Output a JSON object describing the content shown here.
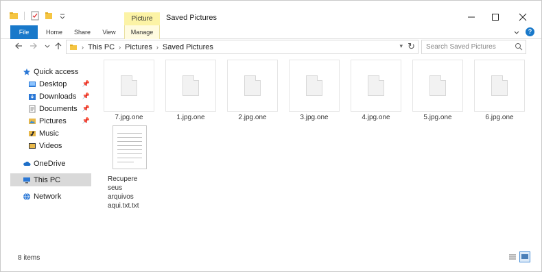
{
  "window": {
    "title": "Saved Pictures",
    "contextual_group": "Picture Tools"
  },
  "ribbon": {
    "tabs": [
      "File",
      "Home",
      "Share",
      "View",
      "Manage"
    ]
  },
  "address": {
    "crumbs": [
      "This PC",
      "Pictures",
      "Saved Pictures"
    ]
  },
  "search": {
    "placeholder": "Search Saved Pictures"
  },
  "sidebar": {
    "items": [
      {
        "label": "Quick access",
        "icon": "star-icon"
      },
      {
        "label": "Desktop",
        "icon": "desktop-folder-icon",
        "pinned": true
      },
      {
        "label": "Downloads",
        "icon": "downloads-folder-icon",
        "pinned": true
      },
      {
        "label": "Documents",
        "icon": "documents-folder-icon",
        "pinned": true
      },
      {
        "label": "Pictures",
        "icon": "pictures-folder-icon",
        "pinned": true
      },
      {
        "label": "Music",
        "icon": "music-folder-icon"
      },
      {
        "label": "Videos",
        "icon": "videos-folder-icon"
      },
      {
        "label": "OneDrive",
        "icon": "cloud-icon"
      },
      {
        "label": "This PC",
        "icon": "computer-icon",
        "selected": true
      },
      {
        "label": "Network",
        "icon": "network-icon"
      }
    ]
  },
  "files": [
    {
      "name": "7.jpg.one"
    },
    {
      "name": "1.jpg.one"
    },
    {
      "name": "2.jpg.one"
    },
    {
      "name": "3.jpg.one"
    },
    {
      "name": "4.jpg.one"
    },
    {
      "name": "5.jpg.one"
    },
    {
      "name": "6.jpg.one"
    }
  ],
  "txt_file": {
    "name_line1": "Recupere seus",
    "name_line2": "arquivos",
    "name_line3": "aqui.txt.txt"
  },
  "status": {
    "count": "8 items"
  },
  "colors": {
    "accent": "#1979ca",
    "contextual": "#fcf3a6",
    "selected_nav": "#d9d9d9"
  }
}
